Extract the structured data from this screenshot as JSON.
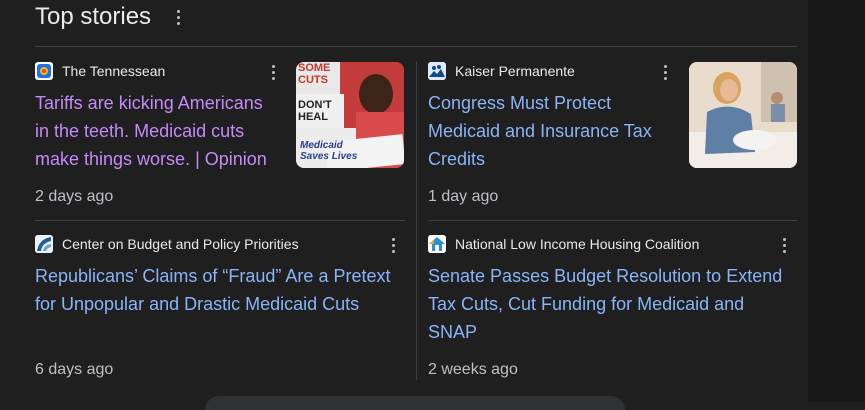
{
  "header": {
    "title": "Top stories"
  },
  "cards": [
    {
      "source": "The Tennessean",
      "headline_lines": [
        "Tariffs are kicking Americans",
        "in the teeth. Medicaid cuts",
        "make things worse. | Opinion"
      ],
      "time": "2 days ago",
      "thumb_text": [
        "SOME",
        "CUTS",
        "DON'T",
        "HEAL",
        "Medicaid",
        "Saves Lives"
      ],
      "icon": "tennessean-favicon"
    },
    {
      "source": "Kaiser Permanente",
      "headline_lines": [
        "Congress Must Protect",
        "Medicaid and Insurance Tax",
        "Credits"
      ],
      "time": "1 day ago",
      "icon": "kaiser-favicon"
    },
    {
      "source": "Center on Budget and Policy Priorities",
      "headline_lines": [
        "Republicans’ Claims of “Fraud” Are a Pretext",
        "for Unpopular and Drastic Medicaid Cuts"
      ],
      "time": "6 days ago",
      "icon": "cbpp-favicon"
    },
    {
      "source": "National Low Income Housing Coalition",
      "headline_lines": [
        "Senate Passes Budget Resolution to Extend",
        "Tax Cuts, Cut Funding for Medicaid and",
        "SNAP"
      ],
      "time": "2 weeks ago",
      "icon": "nlihc-favicon"
    }
  ],
  "colors": {
    "visited_link": "#c58af9",
    "link": "#8ab4f8",
    "background": "#1f1f1f"
  }
}
